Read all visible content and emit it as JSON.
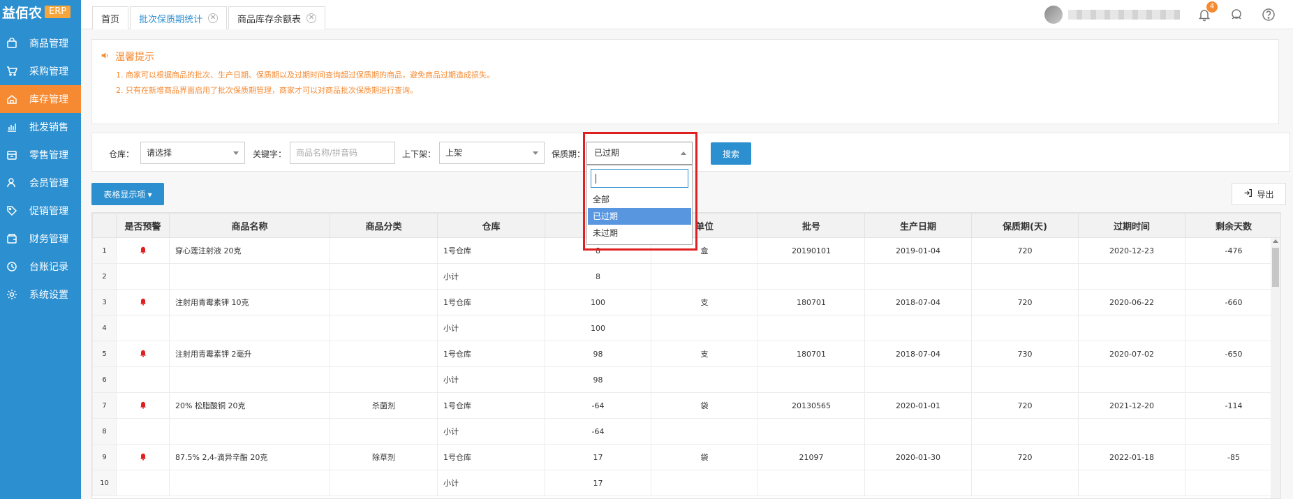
{
  "brand": {
    "name": "益佰农",
    "badge": "ERP"
  },
  "sidebar": {
    "items": [
      {
        "label": "商品管理",
        "icon": "bag-icon"
      },
      {
        "label": "采购管理",
        "icon": "cart-icon"
      },
      {
        "label": "库存管理",
        "icon": "home-icon",
        "active": true
      },
      {
        "label": "批发销售",
        "icon": "chart-icon"
      },
      {
        "label": "零售管理",
        "icon": "store-icon"
      },
      {
        "label": "会员管理",
        "icon": "user-icon"
      },
      {
        "label": "促销管理",
        "icon": "tag-icon"
      },
      {
        "label": "财务管理",
        "icon": "wallet-icon"
      },
      {
        "label": "台账记录",
        "icon": "clock-icon"
      },
      {
        "label": "系统设置",
        "icon": "gear-icon"
      }
    ]
  },
  "tabs": [
    {
      "label": "首页"
    },
    {
      "label": "批次保质期统计"
    },
    {
      "label": "商品库存余额表"
    }
  ],
  "header": {
    "notifications": "4"
  },
  "tip": {
    "title": "温馨提示",
    "line1": "1. 商家可以根据商品的批次、生产日期、保质期以及过期时间查询超过保质期的商品，避免商品过期造成损失。",
    "line2": "2. 只有在新增商品界面启用了批次保质期管理，商家才可以对商品批次保质期进行查询。"
  },
  "filters": {
    "warehouse_label": "仓库：",
    "warehouse_value": "请选择",
    "keyword_label": "关键字：",
    "keyword_placeholder": "商品名称/拼音码",
    "shelf_label": "上下架：",
    "shelf_value": "上架",
    "expiry_label": "保质期：",
    "expiry_value": "已过期",
    "search_button": "搜索"
  },
  "dropdown": {
    "options": [
      "全部",
      "已过期",
      "未过期"
    ],
    "selected": "已过期"
  },
  "toolbar": {
    "columns_button": "表格显示项 ▾",
    "export_button": "导出"
  },
  "table": {
    "headers": [
      "",
      "是否预警",
      "商品名称",
      "商品分类",
      "仓库",
      "",
      "单位",
      "批号",
      "生产日期",
      "保质期(天)",
      "过期时间",
      "剩余天数"
    ],
    "rows": [
      [
        "1",
        "bell",
        "穿心莲注射液 20克",
        "",
        "1号仓库",
        "8",
        "盒",
        "20190101",
        "2019-01-04",
        "720",
        "2020-12-23",
        "-476"
      ],
      [
        "2",
        "",
        "",
        "",
        "小计",
        "8",
        "",
        "",
        "",
        "",
        "",
        ""
      ],
      [
        "3",
        "bell",
        "注射用青霉素钾 10克",
        "",
        "1号仓库",
        "100",
        "支",
        "180701",
        "2018-07-04",
        "720",
        "2020-06-22",
        "-660"
      ],
      [
        "4",
        "",
        "",
        "",
        "小计",
        "100",
        "",
        "",
        "",
        "",
        "",
        ""
      ],
      [
        "5",
        "bell",
        "注射用青霉素钾 2毫升",
        "",
        "1号仓库",
        "98",
        "支",
        "180701",
        "2018-07-04",
        "730",
        "2020-07-02",
        "-650"
      ],
      [
        "6",
        "",
        "",
        "",
        "小计",
        "98",
        "",
        "",
        "",
        "",
        "",
        ""
      ],
      [
        "7",
        "bell",
        "20% 松脂酸铜 20克",
        "杀菌剂",
        "1号仓库",
        "-64",
        "袋",
        "20130565",
        "2020-01-01",
        "720",
        "2021-12-20",
        "-114"
      ],
      [
        "8",
        "",
        "",
        "",
        "小计",
        "-64",
        "",
        "",
        "",
        "",
        "",
        ""
      ],
      [
        "9",
        "bell",
        "87.5% 2,4-滴异辛酯 20克",
        "除草剂",
        "1号仓库",
        "17",
        "袋",
        "21097",
        "2020-01-30",
        "720",
        "2022-01-18",
        "-85"
      ],
      [
        "10",
        "",
        "",
        "",
        "小计",
        "17",
        "",
        "",
        "",
        "",
        "",
        ""
      ]
    ]
  },
  "colors": {
    "primary": "#2b8fd0",
    "accent": "#f58a32",
    "alert": "#e02020"
  }
}
